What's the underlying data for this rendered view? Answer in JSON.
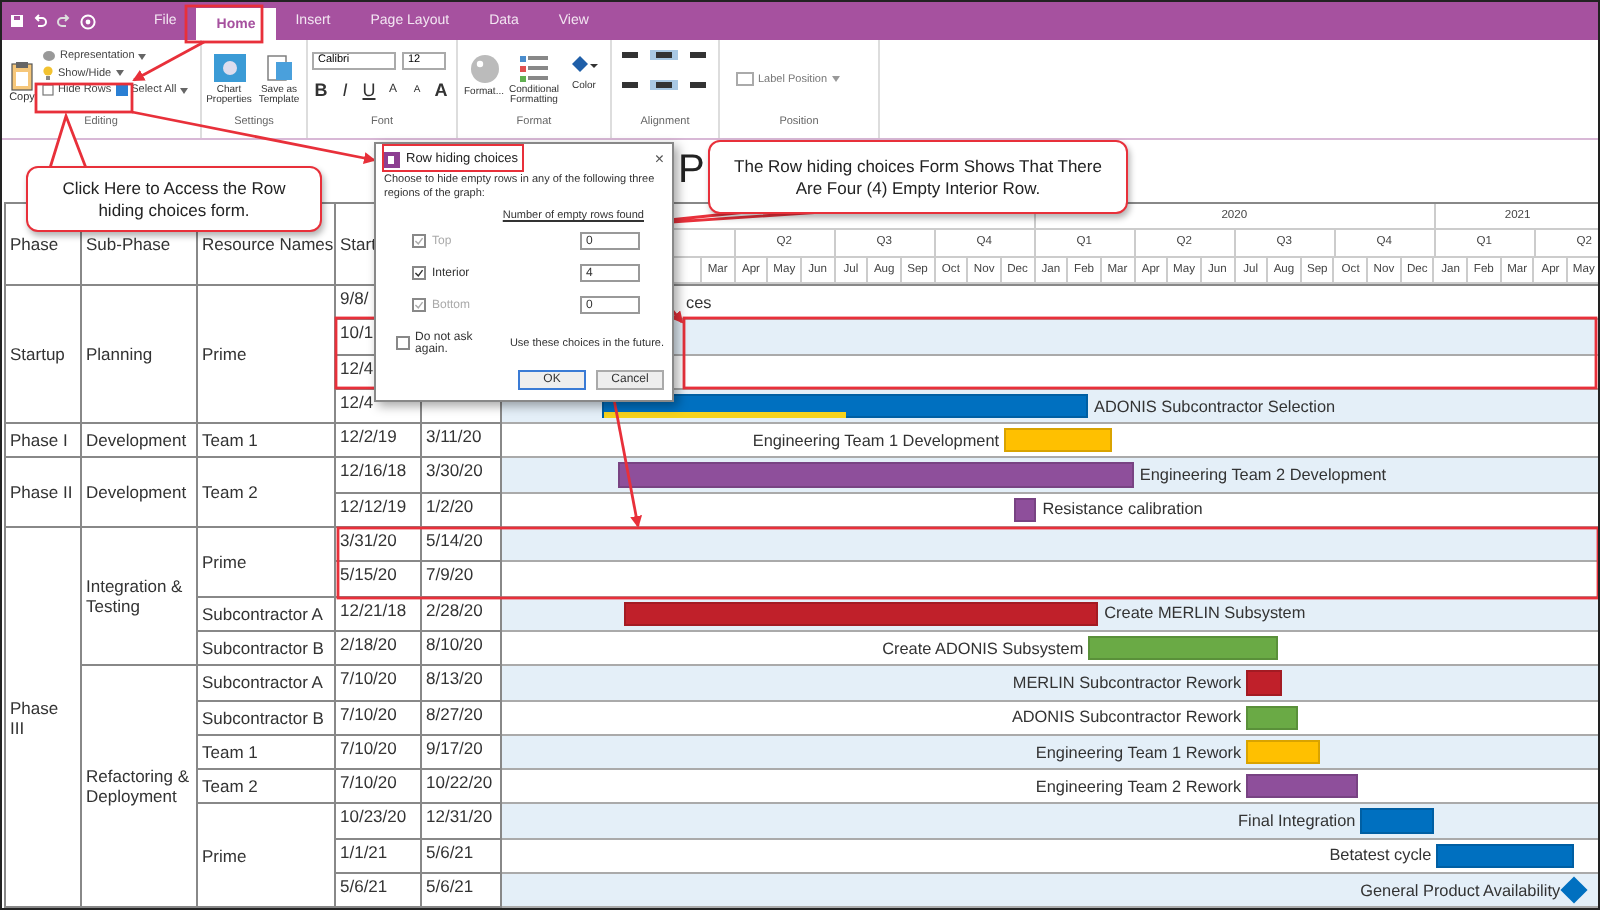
{
  "ribbon": {
    "tabs": [
      {
        "label": "File",
        "selected": false
      },
      {
        "label": "Home",
        "selected": true
      },
      {
        "label": "Insert",
        "selected": false
      },
      {
        "label": "Page Layout",
        "selected": false
      },
      {
        "label": "Data",
        "selected": false
      },
      {
        "label": "View",
        "selected": false
      }
    ],
    "editing": {
      "copy": "Copy",
      "representation": "Representation",
      "show_hide": "Show/Hide",
      "hide_rows": "Hide Rows",
      "select_all": "Select All",
      "label": "Editing"
    },
    "settings": {
      "chart_properties": "Chart Properties",
      "save_template": "Save as Template",
      "label": "Settings"
    },
    "font": {
      "family": "Calibri",
      "size": "12",
      "label": "Font",
      "styles": [
        {
          "label": "B",
          "kind": "bold"
        },
        {
          "label": "I",
          "kind": "italic"
        },
        {
          "label": "U",
          "kind": "underline"
        },
        {
          "label": "A",
          "kind": "grow"
        },
        {
          "label": "A",
          "kind": "shrink"
        },
        {
          "label": "A",
          "kind": "color"
        }
      ]
    },
    "format": {
      "format": "Format...",
      "conditional": "Conditional Formatting",
      "color_label": "Color",
      "label": "Format"
    },
    "alignment": {
      "label": "Alignment",
      "buttons": [
        {
          "selected": false
        },
        {
          "selected": true
        },
        {
          "selected": false
        },
        {
          "selected": false
        },
        {
          "selected": true
        },
        {
          "selected": false
        }
      ]
    },
    "position": {
      "label_position": "Label Position",
      "label": "Position"
    }
  },
  "chart": {
    "title": "P",
    "header": {
      "phase": "Phase",
      "sub_phase": "Sub-Phase",
      "resource": "Resource Names",
      "start": "Start"
    },
    "years": [
      "2020",
      "2021"
    ],
    "quarters": [
      "Q2",
      "Q3",
      "Q4",
      "Q1",
      "Q2",
      "Q3",
      "Q4",
      "Q1",
      "Q2"
    ],
    "months": [
      "Mar",
      "Apr",
      "May",
      "Jun",
      "Jul",
      "Aug",
      "Sep",
      "Oct",
      "Nov",
      "Dec",
      "Jan",
      "Feb",
      "Mar",
      "Apr",
      "May",
      "Jun",
      "Jul",
      "Aug",
      "Sep",
      "Oct",
      "Nov",
      "Dec",
      "Jan",
      "Feb",
      "Mar",
      "Apr",
      "May"
    ],
    "phases": [
      {
        "name": "Startup",
        "subphases": [
          {
            "name": "Planning",
            "resources": [
              {
                "name": "Prime",
                "tasks": [
                  {
                    "start": "9/8/",
                    "kind": "label",
                    "label": "ces"
                  },
                  {
                    "start": "10/1"
                  },
                  {
                    "start": "12/4"
                  },
                  {
                    "start": "12/4",
                    "kind": "open_bar",
                    "label": "ADONIS Subcontractor Selection",
                    "color": "#0070c0",
                    "level": 0.5
                  }
                ]
              }
            ]
          }
        ]
      },
      {
        "name": "Phase I",
        "subphases": [
          {
            "name": "Development",
            "resources": [
              {
                "name": "Team 1",
                "tasks": [
                  {
                    "start": "12/2/19",
                    "finish": "3/11/20",
                    "kind": "bar_left",
                    "label": "Engineering Team 1 Development",
                    "color": "#ffc000"
                  }
                ]
              }
            ]
          }
        ]
      },
      {
        "name": "Phase II",
        "subphases": [
          {
            "name": "Development",
            "resources": [
              {
                "name": "Team 2",
                "tasks": [
                  {
                    "start": "12/16/18",
                    "finish": "3/30/20",
                    "kind": "bar_right",
                    "label": "Engineering Team 2 Development",
                    "color": "#8e4f9b"
                  },
                  {
                    "start": "12/12/19",
                    "finish": "1/2/20",
                    "kind": "bar_right",
                    "label": "Resistance calibration",
                    "color": "#8e4f9b"
                  }
                ]
              }
            ]
          }
        ]
      },
      {
        "name": "Phase III",
        "subphases": [
          {
            "name": "Integration & Testing",
            "resources": [
              {
                "name": "Prime",
                "tasks": [
                  {
                    "start": "3/31/20",
                    "finish": "5/14/20"
                  },
                  {
                    "start": "5/15/20",
                    "finish": "7/9/20"
                  }
                ]
              },
              {
                "name": "Subcontractor A",
                "tasks": [
                  {
                    "start": "12/21/18",
                    "finish": "2/28/20",
                    "kind": "bar_right",
                    "label": "Create MERLIN Subsystem",
                    "color": "#c0202a"
                  }
                ]
              },
              {
                "name": "Subcontractor B",
                "tasks": [
                  {
                    "start": "2/18/20",
                    "finish": "8/10/20",
                    "kind": "bar_left",
                    "label": "Create ADONIS Subsystem",
                    "color": "#6aaa45"
                  }
                ]
              }
            ]
          },
          {
            "name": "Refactoring & Deployment",
            "resources": [
              {
                "name": "Subcontractor A",
                "tasks": [
                  {
                    "start": "7/10/20",
                    "finish": "8/13/20",
                    "kind": "bar_left",
                    "label": "MERLIN Subcontractor Rework",
                    "color": "#c0202a"
                  }
                ]
              },
              {
                "name": "Subcontractor B",
                "tasks": [
                  {
                    "start": "7/10/20",
                    "finish": "8/27/20",
                    "kind": "bar_left",
                    "label": "ADONIS Subcontractor Rework",
                    "color": "#6aaa45"
                  }
                ]
              },
              {
                "name": "Team 1",
                "tasks": [
                  {
                    "start": "7/10/20",
                    "finish": "9/17/20",
                    "kind": "bar_left",
                    "label": "Engineering Team 1 Rework",
                    "color": "#ffc000"
                  }
                ]
              },
              {
                "name": "Team 2",
                "tasks": [
                  {
                    "start": "7/10/20",
                    "finish": "10/22/20",
                    "kind": "bar_left",
                    "label": "Engineering Team 2 Rework",
                    "color": "#8e4f9b"
                  }
                ]
              },
              {
                "name": "Prime",
                "tasks": [
                  {
                    "start": "10/23/20",
                    "finish": "12/31/20",
                    "kind": "bar_left",
                    "label": "Final Integration",
                    "color": "#0070c0"
                  },
                  {
                    "start": "1/1/21",
                    "finish": "5/6/21",
                    "kind": "bar_left",
                    "label": "Betatest cycle",
                    "color": "#0070c0"
                  },
                  {
                    "start": "5/6/21",
                    "finish": "5/6/21",
                    "kind": "milestone",
                    "label": "General Product Availability",
                    "color": "#0070c0"
                  }
                ]
              }
            ]
          }
        ]
      }
    ]
  },
  "dialog": {
    "title": "Row hiding choices",
    "close": "×",
    "intro": "Choose to hide empty rows in any of the following three regions of the graph:",
    "count_heading": "Number of empty rows found",
    "regions": [
      {
        "label": "Top",
        "checked": true,
        "disabled": true,
        "count": "0"
      },
      {
        "label": "Interior",
        "checked": true,
        "disabled": false,
        "count": "4"
      },
      {
        "label": "Bottom",
        "checked": true,
        "disabled": true,
        "count": "0"
      }
    ],
    "remember": {
      "label": "Do not ask again.",
      "checked": false
    },
    "remember_note": "Use these choices in the future.",
    "buttons": [
      {
        "label": "OK",
        "kind": "default"
      },
      {
        "label": "Cancel",
        "kind": "normal"
      }
    ]
  },
  "callouts": [
    {
      "text": "Click Here to Access the Row hiding choices form."
    },
    {
      "text": "The Row hiding choices Form Shows That There Are Four (4) Empty Interior Row."
    }
  ]
}
